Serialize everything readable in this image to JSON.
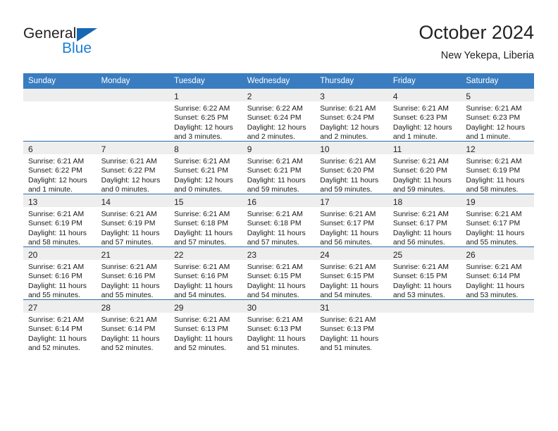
{
  "brand": {
    "word_general": "General",
    "word_blue": "Blue",
    "triangle_color": "#1668b3",
    "blue_text_color": "#1b7fd4"
  },
  "header": {
    "title": "October 2024",
    "subtitle": "New Yekepa, Liberia",
    "header_bg": "#3a7cc0",
    "grid_line_color": "#2f6cb0",
    "daynum_band_color": "#eeeeee"
  },
  "calendar": {
    "weekday_headers": [
      "Sunday",
      "Monday",
      "Tuesday",
      "Wednesday",
      "Thursday",
      "Friday",
      "Saturday"
    ],
    "weeks": [
      [
        {
          "day": "",
          "sunrise": "",
          "sunset": "",
          "daylight_line1": "",
          "daylight_line2": ""
        },
        {
          "day": "",
          "sunrise": "",
          "sunset": "",
          "daylight_line1": "",
          "daylight_line2": ""
        },
        {
          "day": "1",
          "sunrise": "Sunrise: 6:22 AM",
          "sunset": "Sunset: 6:25 PM",
          "daylight_line1": "Daylight: 12 hours",
          "daylight_line2": "and 3 minutes."
        },
        {
          "day": "2",
          "sunrise": "Sunrise: 6:22 AM",
          "sunset": "Sunset: 6:24 PM",
          "daylight_line1": "Daylight: 12 hours",
          "daylight_line2": "and 2 minutes."
        },
        {
          "day": "3",
          "sunrise": "Sunrise: 6:21 AM",
          "sunset": "Sunset: 6:24 PM",
          "daylight_line1": "Daylight: 12 hours",
          "daylight_line2": "and 2 minutes."
        },
        {
          "day": "4",
          "sunrise": "Sunrise: 6:21 AM",
          "sunset": "Sunset: 6:23 PM",
          "daylight_line1": "Daylight: 12 hours",
          "daylight_line2": "and 1 minute."
        },
        {
          "day": "5",
          "sunrise": "Sunrise: 6:21 AM",
          "sunset": "Sunset: 6:23 PM",
          "daylight_line1": "Daylight: 12 hours",
          "daylight_line2": "and 1 minute."
        }
      ],
      [
        {
          "day": "6",
          "sunrise": "Sunrise: 6:21 AM",
          "sunset": "Sunset: 6:22 PM",
          "daylight_line1": "Daylight: 12 hours",
          "daylight_line2": "and 1 minute."
        },
        {
          "day": "7",
          "sunrise": "Sunrise: 6:21 AM",
          "sunset": "Sunset: 6:22 PM",
          "daylight_line1": "Daylight: 12 hours",
          "daylight_line2": "and 0 minutes."
        },
        {
          "day": "8",
          "sunrise": "Sunrise: 6:21 AM",
          "sunset": "Sunset: 6:21 PM",
          "daylight_line1": "Daylight: 12 hours",
          "daylight_line2": "and 0 minutes."
        },
        {
          "day": "9",
          "sunrise": "Sunrise: 6:21 AM",
          "sunset": "Sunset: 6:21 PM",
          "daylight_line1": "Daylight: 11 hours",
          "daylight_line2": "and 59 minutes."
        },
        {
          "day": "10",
          "sunrise": "Sunrise: 6:21 AM",
          "sunset": "Sunset: 6:20 PM",
          "daylight_line1": "Daylight: 11 hours",
          "daylight_line2": "and 59 minutes."
        },
        {
          "day": "11",
          "sunrise": "Sunrise: 6:21 AM",
          "sunset": "Sunset: 6:20 PM",
          "daylight_line1": "Daylight: 11 hours",
          "daylight_line2": "and 59 minutes."
        },
        {
          "day": "12",
          "sunrise": "Sunrise: 6:21 AM",
          "sunset": "Sunset: 6:19 PM",
          "daylight_line1": "Daylight: 11 hours",
          "daylight_line2": "and 58 minutes."
        }
      ],
      [
        {
          "day": "13",
          "sunrise": "Sunrise: 6:21 AM",
          "sunset": "Sunset: 6:19 PM",
          "daylight_line1": "Daylight: 11 hours",
          "daylight_line2": "and 58 minutes."
        },
        {
          "day": "14",
          "sunrise": "Sunrise: 6:21 AM",
          "sunset": "Sunset: 6:19 PM",
          "daylight_line1": "Daylight: 11 hours",
          "daylight_line2": "and 57 minutes."
        },
        {
          "day": "15",
          "sunrise": "Sunrise: 6:21 AM",
          "sunset": "Sunset: 6:18 PM",
          "daylight_line1": "Daylight: 11 hours",
          "daylight_line2": "and 57 minutes."
        },
        {
          "day": "16",
          "sunrise": "Sunrise: 6:21 AM",
          "sunset": "Sunset: 6:18 PM",
          "daylight_line1": "Daylight: 11 hours",
          "daylight_line2": "and 57 minutes."
        },
        {
          "day": "17",
          "sunrise": "Sunrise: 6:21 AM",
          "sunset": "Sunset: 6:17 PM",
          "daylight_line1": "Daylight: 11 hours",
          "daylight_line2": "and 56 minutes."
        },
        {
          "day": "18",
          "sunrise": "Sunrise: 6:21 AM",
          "sunset": "Sunset: 6:17 PM",
          "daylight_line1": "Daylight: 11 hours",
          "daylight_line2": "and 56 minutes."
        },
        {
          "day": "19",
          "sunrise": "Sunrise: 6:21 AM",
          "sunset": "Sunset: 6:17 PM",
          "daylight_line1": "Daylight: 11 hours",
          "daylight_line2": "and 55 minutes."
        }
      ],
      [
        {
          "day": "20",
          "sunrise": "Sunrise: 6:21 AM",
          "sunset": "Sunset: 6:16 PM",
          "daylight_line1": "Daylight: 11 hours",
          "daylight_line2": "and 55 minutes."
        },
        {
          "day": "21",
          "sunrise": "Sunrise: 6:21 AM",
          "sunset": "Sunset: 6:16 PM",
          "daylight_line1": "Daylight: 11 hours",
          "daylight_line2": "and 55 minutes."
        },
        {
          "day": "22",
          "sunrise": "Sunrise: 6:21 AM",
          "sunset": "Sunset: 6:16 PM",
          "daylight_line1": "Daylight: 11 hours",
          "daylight_line2": "and 54 minutes."
        },
        {
          "day": "23",
          "sunrise": "Sunrise: 6:21 AM",
          "sunset": "Sunset: 6:15 PM",
          "daylight_line1": "Daylight: 11 hours",
          "daylight_line2": "and 54 minutes."
        },
        {
          "day": "24",
          "sunrise": "Sunrise: 6:21 AM",
          "sunset": "Sunset: 6:15 PM",
          "daylight_line1": "Daylight: 11 hours",
          "daylight_line2": "and 54 minutes."
        },
        {
          "day": "25",
          "sunrise": "Sunrise: 6:21 AM",
          "sunset": "Sunset: 6:15 PM",
          "daylight_line1": "Daylight: 11 hours",
          "daylight_line2": "and 53 minutes."
        },
        {
          "day": "26",
          "sunrise": "Sunrise: 6:21 AM",
          "sunset": "Sunset: 6:14 PM",
          "daylight_line1": "Daylight: 11 hours",
          "daylight_line2": "and 53 minutes."
        }
      ],
      [
        {
          "day": "27",
          "sunrise": "Sunrise: 6:21 AM",
          "sunset": "Sunset: 6:14 PM",
          "daylight_line1": "Daylight: 11 hours",
          "daylight_line2": "and 52 minutes."
        },
        {
          "day": "28",
          "sunrise": "Sunrise: 6:21 AM",
          "sunset": "Sunset: 6:14 PM",
          "daylight_line1": "Daylight: 11 hours",
          "daylight_line2": "and 52 minutes."
        },
        {
          "day": "29",
          "sunrise": "Sunrise: 6:21 AM",
          "sunset": "Sunset: 6:13 PM",
          "daylight_line1": "Daylight: 11 hours",
          "daylight_line2": "and 52 minutes."
        },
        {
          "day": "30",
          "sunrise": "Sunrise: 6:21 AM",
          "sunset": "Sunset: 6:13 PM",
          "daylight_line1": "Daylight: 11 hours",
          "daylight_line2": "and 51 minutes."
        },
        {
          "day": "31",
          "sunrise": "Sunrise: 6:21 AM",
          "sunset": "Sunset: 6:13 PM",
          "daylight_line1": "Daylight: 11 hours",
          "daylight_line2": "and 51 minutes."
        },
        {
          "day": "",
          "sunrise": "",
          "sunset": "",
          "daylight_line1": "",
          "daylight_line2": ""
        },
        {
          "day": "",
          "sunrise": "",
          "sunset": "",
          "daylight_line1": "",
          "daylight_line2": ""
        }
      ]
    ]
  }
}
